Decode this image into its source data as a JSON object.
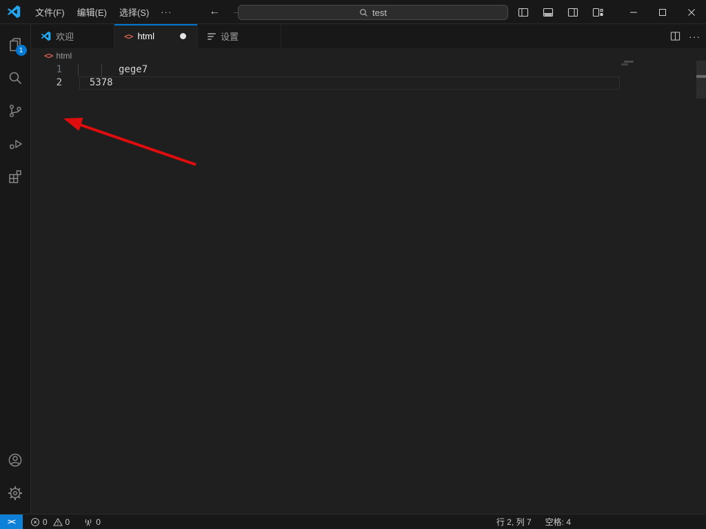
{
  "titlebar": {
    "menu": [
      "文件(F)",
      "编辑(E)",
      "选择(S)"
    ],
    "menu_overflow": "···",
    "search_value": "test"
  },
  "tabs": {
    "items": [
      {
        "label": "欢迎"
      },
      {
        "label": "html",
        "modified": true
      },
      {
        "label": "设置"
      }
    ],
    "overflow": "···"
  },
  "breadcrumb": {
    "segment": "html"
  },
  "editor": {
    "language": "html",
    "lines": [
      {
        "number": "1",
        "text": "       gege7"
      },
      {
        "number": "2",
        "text": "  5378"
      }
    ]
  },
  "activity_bar": {
    "explorer_badge": "1"
  },
  "statusbar": {
    "remote_icon": "><",
    "errors": "0",
    "warnings": "0",
    "ports": "0",
    "cursor": "行 2, 列 7",
    "indent": "空格: 4"
  },
  "colors": {
    "accent_blue": "#0078d4",
    "arrow_red": "#df0d0d",
    "html_icon_orange": "#d1604d",
    "badge_blue": "#0078d4",
    "remote_bg_blue": "#0f80d7",
    "logo_blue": "#24a4ec"
  }
}
